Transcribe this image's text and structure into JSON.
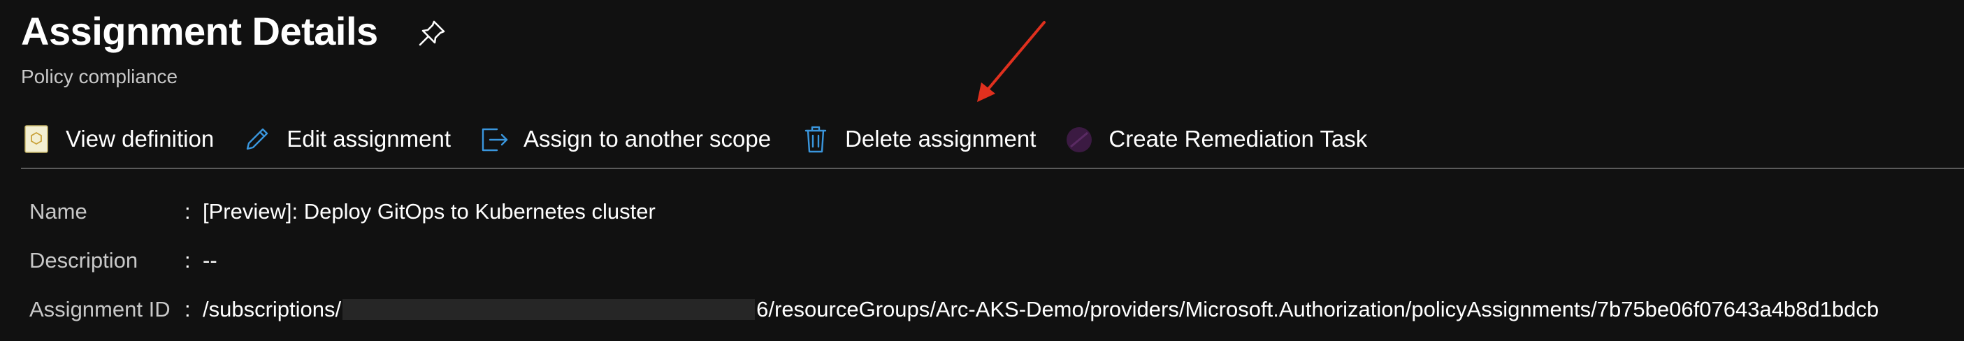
{
  "header": {
    "title": "Assignment Details",
    "subtitle": "Policy compliance",
    "pin_icon": "pin-icon"
  },
  "toolbar": {
    "items": [
      {
        "label": "View definition",
        "icon": "policy-definition-icon"
      },
      {
        "label": "Edit assignment",
        "icon": "pencil-icon"
      },
      {
        "label": "Assign to another scope",
        "icon": "assign-scope-icon"
      },
      {
        "label": "Delete assignment",
        "icon": "trash-icon"
      },
      {
        "label": "Create Remediation Task",
        "icon": "remediation-icon"
      }
    ]
  },
  "details": {
    "name": {
      "label": "Name",
      "separator": ":",
      "value": "[Preview]: Deploy GitOps to Kubernetes cluster"
    },
    "description": {
      "label": "Description",
      "separator": ":",
      "value": "--"
    },
    "assignment_id": {
      "label": "Assignment ID",
      "separator": ":",
      "value_prefix": "/subscriptions/",
      "value_suffix": "6/resourceGroups/Arc-AKS-Demo/providers/Microsoft.Authorization/policyAssignments/7b75be06f07643a4b8d1bdcb"
    }
  },
  "colors": {
    "background": "#111111",
    "text": "#ffffff",
    "muted_text": "#c8c8c8",
    "accent_blue": "#3a96dd",
    "annotation_red": "#e0301e",
    "divider": "#5a5a5a"
  }
}
